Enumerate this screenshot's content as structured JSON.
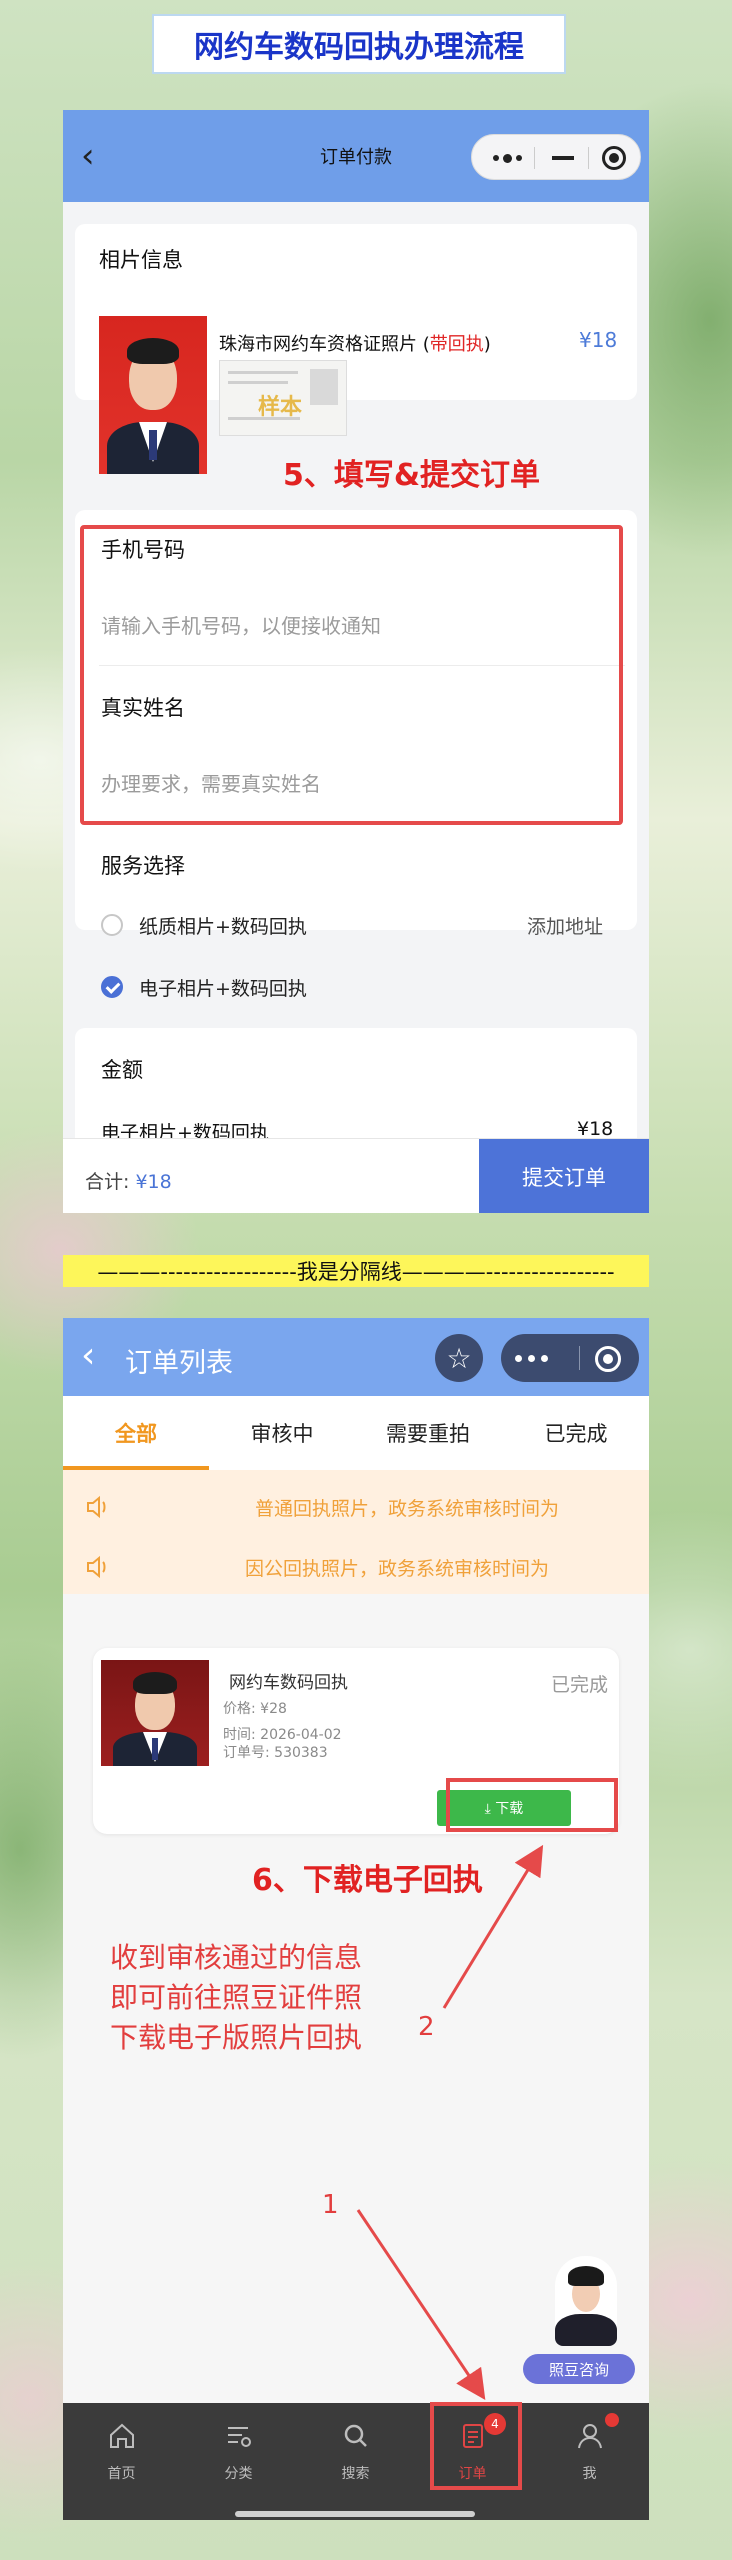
{
  "banner_title": "网约车数码回执办理流程",
  "checkout": {
    "nav_title": "订单付款",
    "photo_section_title": "相片信息",
    "product_name": "珠海市网约车资格证照片",
    "product_tag_open": " (",
    "product_tag": "带回执",
    "product_tag_close": ")",
    "product_price": "¥18",
    "sample_stamp": "样本",
    "step5_label": "5、填写&提交订单",
    "phone_label": "手机号码",
    "phone_placeholder": "请输入手机号码，以便接收通知",
    "name_label": "真实姓名",
    "name_placeholder": "办理要求，需要真实姓名",
    "service_title": "服务选择",
    "service_options": [
      {
        "label": "纸质相片+数码回执",
        "selected": false
      },
      {
        "label": "电子相片+数码回执",
        "selected": true
      }
    ],
    "add_address": "添加地址",
    "amount_title": "金额",
    "amount_item": "电子相片+数码回执",
    "amount_item_price": "¥18",
    "total_label": "合计:",
    "total_value": "¥18",
    "submit_label": "提交订单",
    "accent_color": "#4d73d8"
  },
  "separator_text": "———------------------我是分隔线————-----------------",
  "orders": {
    "nav_title": "订单列表",
    "tabs": [
      {
        "label": "全部",
        "active": true
      },
      {
        "label": "审核中",
        "active": false
      },
      {
        "label": "需要重拍",
        "active": false
      },
      {
        "label": "已完成",
        "active": false
      }
    ],
    "notices": [
      "普通回执照片，政务系统审核时间为",
      "因公回执照片，政务系统审核时间为"
    ],
    "order": {
      "name": "网约车数码回执",
      "status": "已完成",
      "price": "价格: ¥28",
      "time": "时间: 2026-04-02",
      "order_no": "订单号: 530383",
      "download_label": "⤓ 下载"
    },
    "step6_label": "6、下载电子回执",
    "hint_lines": [
      "收到审核通过的信息",
      "即可前往照豆证件照",
      "下载电子版照片回执"
    ],
    "arrow_num_1": "1",
    "arrow_num_2": "2",
    "consult_label": "照豆咨询",
    "tabbar": [
      {
        "label": "首页",
        "icon": "home-icon"
      },
      {
        "label": "分类",
        "icon": "category-icon"
      },
      {
        "label": "搜索",
        "icon": "search-icon"
      },
      {
        "label": "订单",
        "icon": "order-icon",
        "active": true,
        "badge": "4"
      },
      {
        "label": "我",
        "icon": "user-icon"
      }
    ]
  }
}
